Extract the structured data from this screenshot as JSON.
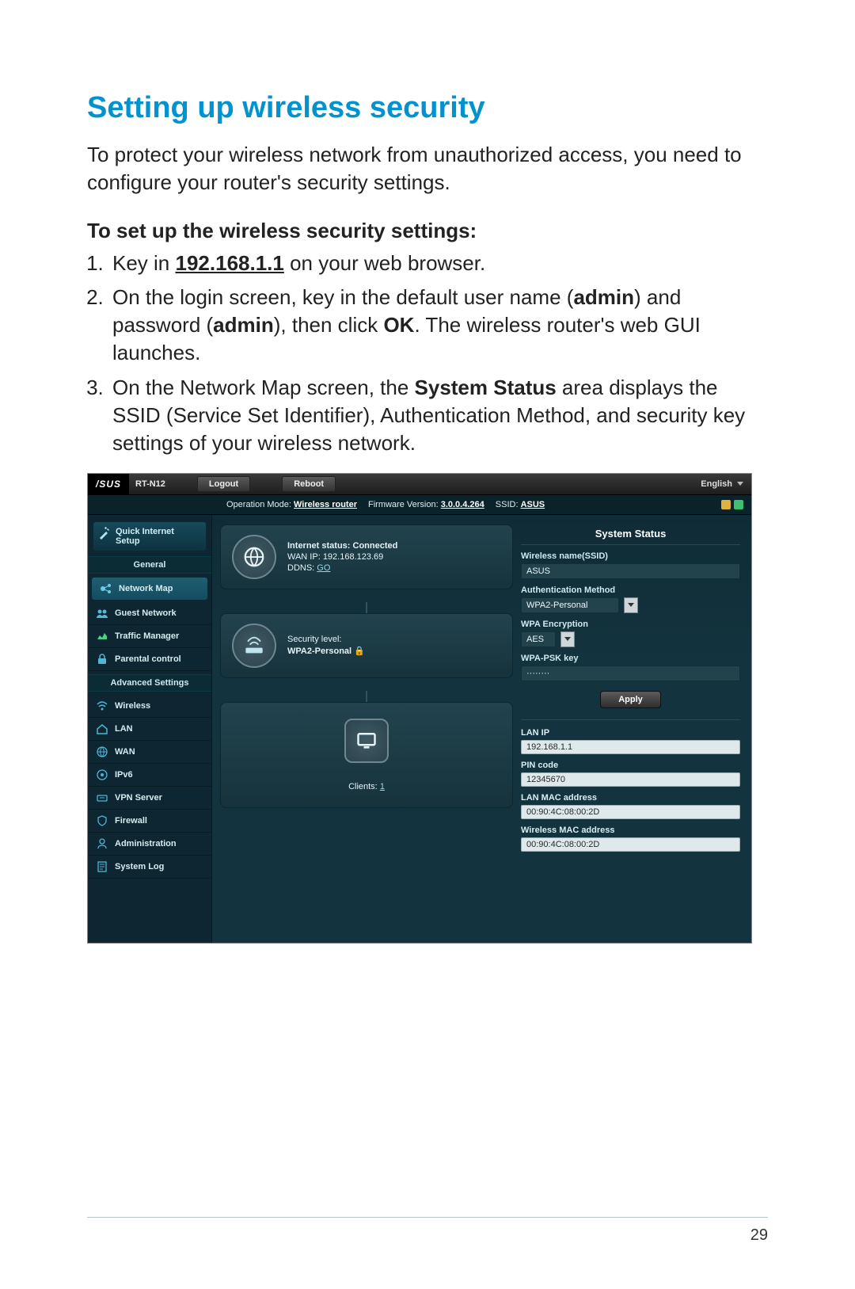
{
  "doc": {
    "title": "Setting up wireless security",
    "intro": "To protect your wireless network from unauthorized access, you need to configure your router's security settings.",
    "subhead": "To set up the wireless security settings:",
    "step1_a": "Key in ",
    "step1_ip": "192.168.1.1",
    "step1_b": " on your web browser.",
    "step2_a": "On the login screen, key in the default user name (",
    "step2_admin": "admin",
    "step2_b": ") and password (",
    "step2_c": "), then click ",
    "step2_ok": "OK",
    "step2_d": ". The wireless router's web GUI launches.",
    "step3_a": "On the Network Map screen, the ",
    "step3_ss": "System Status",
    "step3_b": " area displays the SSID (Service Set Identifier), Authentication Method, and security key settings of your wireless network.",
    "page_number": "29"
  },
  "gui": {
    "brand": "/SUS",
    "model": "RT-N12",
    "logout": "Logout",
    "reboot": "Reboot",
    "language": "English",
    "status": {
      "op_label": "Operation Mode:",
      "op_value": "Wireless router",
      "fw_label": "Firmware Version:",
      "fw_value": "3.0.0.4.264",
      "ssid_label": "SSID:",
      "ssid_value": "ASUS"
    },
    "quick_internet": "Quick Internet\nSetup",
    "section_general": "General",
    "section_advanced": "Advanced Settings",
    "nav_general": [
      "Network Map",
      "Guest Network",
      "Traffic Manager",
      "Parental control"
    ],
    "nav_advanced": [
      "Wireless",
      "LAN",
      "WAN",
      "IPv6",
      "VPN Server",
      "Firewall",
      "Administration",
      "System Log"
    ],
    "card1": {
      "status": "Internet status: Connected",
      "wanip": "WAN IP: 192.168.123.69",
      "ddns_label": "DDNS: ",
      "ddns_link": "GO"
    },
    "card2": {
      "label": "Security level:",
      "value": "WPA2-Personal"
    },
    "card3": {
      "label": "Clients: ",
      "value": "1"
    },
    "panel": {
      "title": "System Status",
      "ssid_label": "Wireless name(SSID)",
      "ssid_value": "ASUS",
      "auth_label": "Authentication Method",
      "auth_value": "WPA2-Personal",
      "enc_label": "WPA Encryption",
      "enc_value": "AES",
      "psk_label": "WPA-PSK key",
      "psk_value": "········",
      "apply": "Apply",
      "lanip_label": "LAN IP",
      "lanip_value": "192.168.1.1",
      "pin_label": "PIN code",
      "pin_value": "12345670",
      "lanmac_label": "LAN MAC address",
      "lanmac_value": "00:90:4C:08:00:2D",
      "wmac_label": "Wireless MAC address",
      "wmac_value": "00:90:4C:08:00:2D"
    }
  }
}
